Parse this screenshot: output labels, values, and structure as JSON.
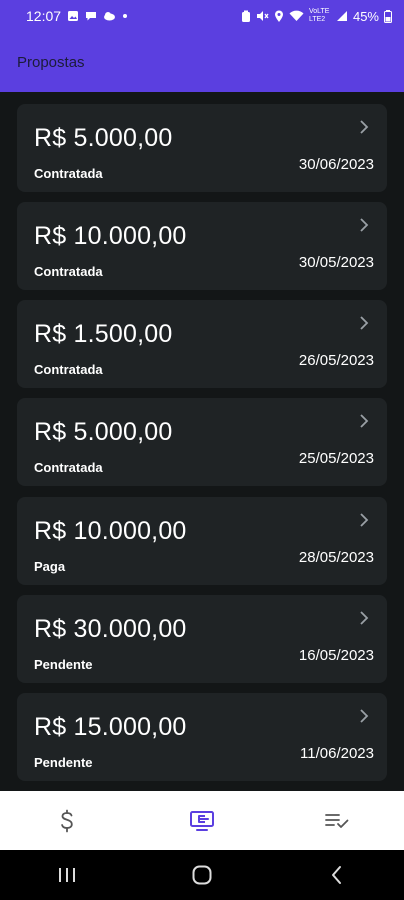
{
  "status_bar": {
    "time": "12:07",
    "battery": "45%",
    "network_label": "VoLTE LTE2"
  },
  "app_bar": {
    "title": "Propostas"
  },
  "proposals": [
    {
      "amount": "R$ 5.000,00",
      "status": "Contratada",
      "date": "30/06/2023"
    },
    {
      "amount": "R$ 10.000,00",
      "status": "Contratada",
      "date": "30/05/2023"
    },
    {
      "amount": "R$ 1.500,00",
      "status": "Contratada",
      "date": "26/05/2023"
    },
    {
      "amount": "R$ 5.000,00",
      "status": "Contratada",
      "date": "25/05/2023"
    },
    {
      "amount": "R$ 10.000,00",
      "status": "Paga",
      "date": "28/05/2023"
    },
    {
      "amount": "R$ 30.000,00",
      "status": "Pendente",
      "date": "16/05/2023"
    },
    {
      "amount": "R$ 15.000,00",
      "status": "Pendente",
      "date": "11/06/2023"
    }
  ],
  "bottom_nav": {
    "items": [
      {
        "icon": "dollar-icon",
        "active": false
      },
      {
        "icon": "proposals-icon",
        "active": true
      },
      {
        "icon": "checklist-icon",
        "active": false
      }
    ]
  },
  "colors": {
    "primary": "#5b3fe0",
    "background": "#131617",
    "card": "#1f2325",
    "nav_active": "#5b3fe0",
    "nav_inactive": "#555555"
  }
}
